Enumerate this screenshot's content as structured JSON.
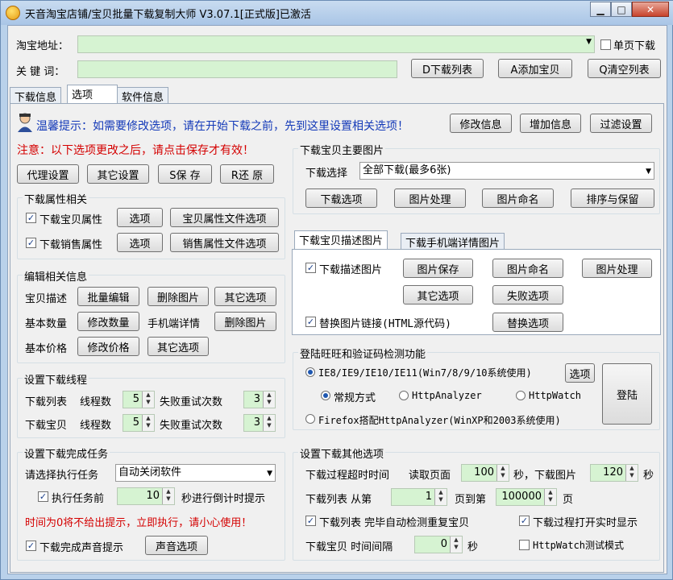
{
  "window": {
    "title": "天音淘宝店铺/宝贝批量下载复制大师 V3.07.1[正式版]已激活",
    "buttons": {
      "minimize": "▁",
      "maximize": "□",
      "close": "✕"
    }
  },
  "top": {
    "url_label": "淘宝地址：",
    "single_page_label": "单页下载",
    "keyword_label": "关 键 词：",
    "download_list_btn": "D下载列表",
    "add_item_btn": "A添加宝贝",
    "clear_list_btn": "Q清空列表"
  },
  "tabs": [
    "下载信息",
    "选项",
    "软件信息"
  ],
  "tip": {
    "text": "温馨提示：如需要修改选项，请在开始下载之前，先到这里设置相关选项！",
    "modify_btn": "修改信息",
    "add_btn": "增加信息",
    "filter_btn": "过滤设置"
  },
  "notice": "注意：以下选项更改之后，请点击保存才有效！",
  "actions": {
    "proxy": "代理设置",
    "other": "其它设置",
    "save": "S保  存",
    "restore": "R还  原"
  },
  "attr_group": {
    "title": "下载属性相关",
    "item_attr_label": "下载宝贝属性",
    "sales_attr_label": "下载销售属性",
    "options_btn": "选项",
    "item_attr_file_btn": "宝贝属性文件选项",
    "sales_attr_file_btn": "销售属性文件选项"
  },
  "edit_group": {
    "title": "编辑相关信息",
    "desc_label": "宝贝描述",
    "batch_edit_btn": "批量编辑",
    "delete_img_btn": "删除图片",
    "other_opts_btn": "其它选项",
    "base_qty_label": "基本数量",
    "modify_qty_btn": "修改数量",
    "mobile_detail_label": "手机端详情",
    "base_price_label": "基本价格",
    "modify_price_btn": "修改价格"
  },
  "thread_group": {
    "title": "设置下载线程",
    "list_label": "下载列表",
    "item_label": "下载宝贝",
    "threads_label": "线程数",
    "retry_label": "失败重试次数",
    "list_threads": "5",
    "list_retry": "3",
    "item_threads": "5",
    "item_retry": "3"
  },
  "finish_group": {
    "title": "设置下载完成任务",
    "select_task_label": "请选择执行任务",
    "task_value": "自动关闭软件",
    "before_task_label": "执行任务前",
    "countdown_value": "10",
    "countdown_suffix": "秒进行倒计时提示",
    "warning": "时间为0将不给出提示，立即执行，请小心使用！",
    "sound_label": "下载完成声音提示",
    "sound_btn": "声音选项"
  },
  "main_img_group": {
    "title": "下载宝贝主要图片",
    "select_label": "下载选择",
    "select_value": "全部下载(最多6张)",
    "dl_options_btn": "下载选项",
    "img_process_btn": "图片处理",
    "img_naming_btn": "图片命名",
    "sort_keep_btn": "排序与保留"
  },
  "desc_tabs": [
    "下载宝贝描述图片",
    "下载手机端详情图片"
  ],
  "desc_group": {
    "dl_desc_label": "下载描述图片",
    "img_save_btn": "图片保存",
    "img_naming_btn": "图片命名",
    "img_process_btn": "图片处理",
    "other_opts_btn": "其它选项",
    "fail_opts_btn": "失败选项",
    "replace_link_label": "替换图片链接(HTML源代码)",
    "replace_opts_btn": "替换选项"
  },
  "login_group": {
    "title": "登陆旺旺和验证码检测功能",
    "ie_label": "IE8/IE9/IE10/IE11(Win7/8/9/10系统使用)",
    "options_btn": "选项",
    "login_btn": "登陆",
    "normal_label": "常规方式",
    "httpanalyzer_label": "HttpAnalyzer",
    "httpwatch_label": "HttpWatch",
    "firefox_label": "Firefox搭配HttpAnalyzer(WinXP和2003系统使用)"
  },
  "other_group": {
    "title": "设置下载其他选项",
    "timeout_label": "下载过程超时时间",
    "read_page_label": "读取页面",
    "read_page_value": "100",
    "sec_dl_img_label": "秒，下载图片",
    "img_timeout_value": "120",
    "sec_label": "秒",
    "list_from_label": "下载列表  从第",
    "from_value": "1",
    "page_to_label": "页到第",
    "to_value": "100000",
    "page_label": "页",
    "auto_dup_label": "下载列表  完毕自动检测重复宝贝",
    "realtime_label": "下载过程打开实时显示",
    "item_interval_label": "下载宝贝  时间间隔",
    "interval_value": "0",
    "interval_sec": "秒",
    "httpwatch_test_label": "HttpWatch测试模式"
  }
}
